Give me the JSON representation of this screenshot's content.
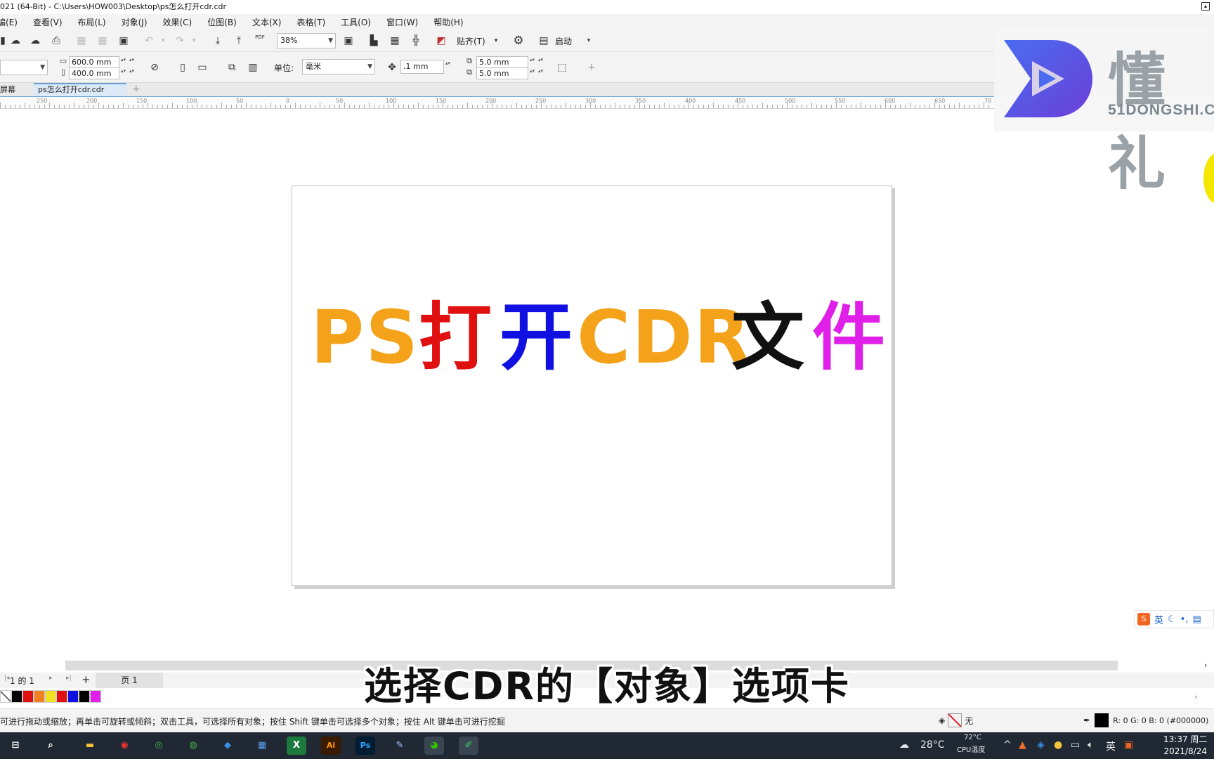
{
  "window": {
    "title": "021 (64-Bit) - C:\\Users\\HOW003\\Desktop\\ps怎么打开cdr.cdr"
  },
  "menu": [
    "编(E)",
    "查看(V)",
    "布局(L)",
    "对象(J)",
    "效果(C)",
    "位图(B)",
    "文本(X)",
    "表格(T)",
    "工具(O)",
    "窗口(W)",
    "帮助(H)"
  ],
  "toolbar1": {
    "zoom": "38%",
    "snap_label": "贴齐(T)",
    "launch_label": "启动",
    "pdf_label": "PDF"
  },
  "toolbar2": {
    "width": "600.0 mm",
    "height": "400.0 mm",
    "unit_label": "单位:",
    "unit_value": "毫米",
    "nudge": ".1 mm",
    "dup_x": "5.0 mm",
    "dup_y": "5.0 mm"
  },
  "doc_tabs": [
    "屏幕",
    "ps怎么打开cdr.cdr"
  ],
  "ruler_labels": [
    "250",
    "200",
    "150",
    "100",
    "50",
    "0",
    "50",
    "100",
    "150",
    "200",
    "250",
    "300",
    "350",
    "400",
    "450",
    "500",
    "550",
    "600",
    "650",
    "70"
  ],
  "artwork": {
    "words": [
      "PS",
      "打",
      "开",
      "CDR",
      "文",
      "件"
    ],
    "colors": [
      "#f3a21a",
      "#e01010",
      "#1010e0",
      "#f3a21a",
      "#111111",
      "#e020e8"
    ]
  },
  "watermark": {
    "brand_text": "懂 礼",
    "site": "51DONGSHI.C"
  },
  "ime": {
    "lang": "英"
  },
  "page_nav": {
    "position": "1 的 1",
    "page_tab": "页 1"
  },
  "palette": [
    "#ffffff",
    "#000000",
    "#e01010",
    "#f08020",
    "#f0e020",
    "#e01010",
    "#1010e0",
    "#000000",
    "#e020e8"
  ],
  "subtitle": "选择CDR的【对象】选项卡",
  "status": {
    "message": "可进行拖动或缩放；再单击可旋转或倾斜；双击工具，可选择所有对象；按住 Shift 键单击可选择多个对象；按住 Alt 键单击可进行挖掘",
    "fill_label": "无",
    "color_readout": "R: 0 G: 0 B: 0 (#000000)"
  },
  "taskbar": {
    "weather": "28°C",
    "cpu_temp": "72°C",
    "cpu_label": "CPU温度",
    "tray_lang": "英",
    "time": "13:37 周二",
    "date": "2021/8/24"
  }
}
